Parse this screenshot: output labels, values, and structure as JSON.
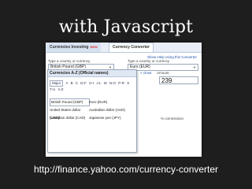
{
  "slide": {
    "title": "with Javascript",
    "caption": "http://finance.yahoo.com/currency-converter"
  },
  "tabs": [
    {
      "label": "Currencies Investing",
      "badge": "NEW"
    },
    {
      "label": "Currency Converter"
    }
  ],
  "help_link": "Show Help using this Converter",
  "from": {
    "label": "Type a country or currency",
    "value": "British Pound (GBP)"
  },
  "to": {
    "label": "Type a country or currency",
    "value": "Euro (EUR)"
  },
  "picker": {
    "title": "Currencies A-Z (Official names)",
    "close": "close",
    "alpha": [
      "Major",
      "A",
      "B",
      "C",
      "D-F",
      "G-I",
      "J-L",
      "M",
      "N-O",
      "P-R",
      "S",
      "T-U",
      "V-Z"
    ],
    "rows": [
      [
        "British Pound (GBP)",
        "Euro (EUR)"
      ],
      [
        "United States dollar (USD)",
        "Australian dollar (AUD)"
      ],
      [
        "Canadian dollar (CAD)",
        "Japanese yen (JPY)"
      ]
    ]
  },
  "amount": {
    "label": "Amount",
    "value": "239"
  },
  "commission": "% commission"
}
